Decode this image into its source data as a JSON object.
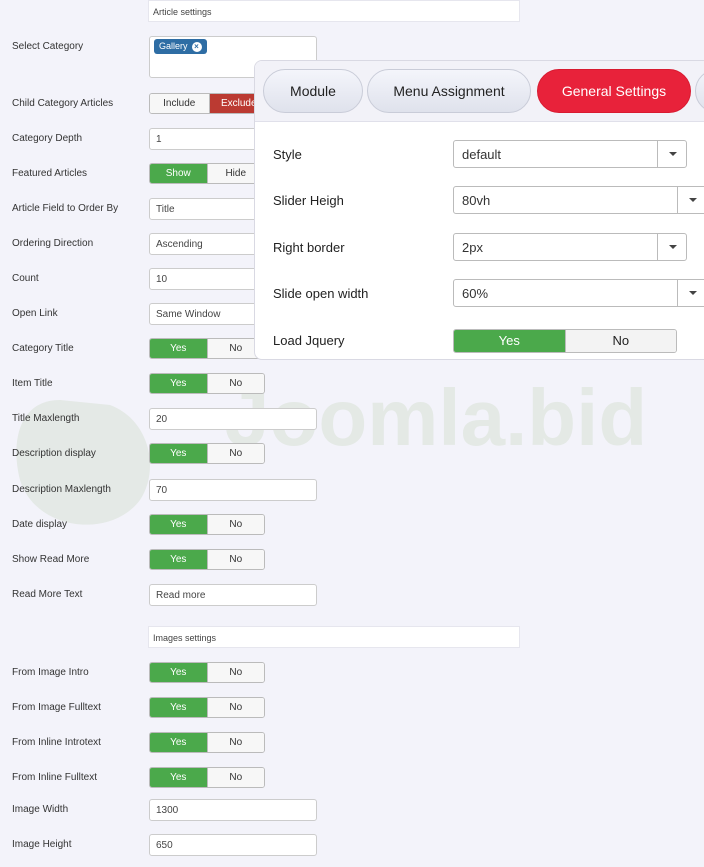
{
  "article_settings": {
    "heading": "Article settings",
    "select_category": {
      "label": "Select Category",
      "tag": "Gallery"
    },
    "child_category_articles": {
      "label": "Child Category Articles",
      "options": [
        "Include",
        "Exclude"
      ],
      "selected": "Exclude"
    },
    "category_depth": {
      "label": "Category Depth",
      "value": "1"
    },
    "featured_articles": {
      "label": "Featured Articles",
      "options": [
        "Show",
        "Hide"
      ],
      "selected": "Show"
    },
    "order_by": {
      "label": "Article Field to Order By",
      "value": "Title"
    },
    "ordering_direction": {
      "label": "Ordering Direction",
      "value": "Ascending"
    },
    "count": {
      "label": "Count",
      "value": "10"
    },
    "open_link": {
      "label": "Open Link",
      "value": "Same Window"
    },
    "category_title": {
      "label": "Category Title",
      "options": [
        "Yes",
        "No"
      ],
      "selected": "Yes"
    },
    "item_title": {
      "label": "Item Title",
      "options": [
        "Yes",
        "No"
      ],
      "selected": "Yes"
    },
    "title_maxlength": {
      "label": "Title Maxlength",
      "value": "20"
    },
    "description_display": {
      "label": "Description display",
      "options": [
        "Yes",
        "No"
      ],
      "selected": "Yes"
    },
    "description_maxlength": {
      "label": "Description Maxlength",
      "value": "70"
    },
    "date_display": {
      "label": "Date display",
      "options": [
        "Yes",
        "No"
      ],
      "selected": "Yes"
    },
    "show_read_more": {
      "label": "Show Read More",
      "options": [
        "Yes",
        "No"
      ],
      "selected": "Yes"
    },
    "read_more_text": {
      "label": "Read More Text",
      "value": "Read more"
    }
  },
  "images_settings": {
    "heading": "Images settings",
    "from_image_intro": {
      "label": "From Image Intro",
      "options": [
        "Yes",
        "No"
      ],
      "selected": "Yes"
    },
    "from_image_fulltext": {
      "label": "From Image Fulltext",
      "options": [
        "Yes",
        "No"
      ],
      "selected": "Yes"
    },
    "from_inline_introtext": {
      "label": "From Inline Introtext",
      "options": [
        "Yes",
        "No"
      ],
      "selected": "Yes"
    },
    "from_inline_fulltext": {
      "label": "From Inline Fulltext",
      "options": [
        "Yes",
        "No"
      ],
      "selected": "Yes"
    },
    "image_width": {
      "label": "Image Width",
      "value": "1300"
    },
    "image_height": {
      "label": "Image Height",
      "value": "650"
    }
  },
  "panel": {
    "tabs": [
      "Module",
      "Menu Assignment",
      "General Settings"
    ],
    "active_tab": "General Settings",
    "style": {
      "label": "Style",
      "value": "default"
    },
    "slider_height": {
      "label": "Slider Heigh",
      "value": "80vh"
    },
    "right_border": {
      "label": "Right border",
      "value": "2px"
    },
    "slide_open_width": {
      "label": "Slide open width",
      "value": "60%"
    },
    "load_jquery": {
      "label": "Load Jquery",
      "options": [
        "Yes",
        "No"
      ],
      "selected": "Yes"
    }
  },
  "watermark": {
    "text": "Joomla.bid"
  },
  "colors": {
    "green": "#4ba94b",
    "red_exclude": "#bb3a32",
    "active_tab": "#e8223a",
    "tag_blue": "#2e6da4"
  },
  "icons": {
    "tag_remove": "close-circle-icon",
    "select_caret": "caret-down-icon"
  }
}
